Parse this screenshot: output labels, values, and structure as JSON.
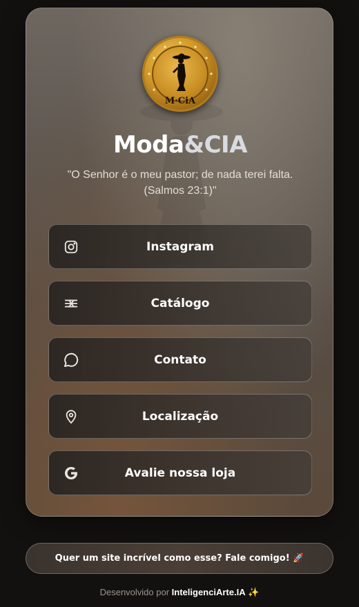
{
  "profile": {
    "brand_prefix": "Moda",
    "brand_suffix": "&CIA",
    "logo_text": "M·CiA",
    "quote_line1": "\"O Senhor é o meu pastor; de nada terei falta.",
    "quote_line2": "(Salmos 23:1)\""
  },
  "links": [
    {
      "label": "Instagram",
      "icon": "instagram-icon"
    },
    {
      "label": "Catálogo",
      "icon": "catalog-icon"
    },
    {
      "label": "Contato",
      "icon": "chat-bubble-icon"
    },
    {
      "label": "Localização",
      "icon": "map-pin-icon"
    },
    {
      "label": "Avalie nossa loja",
      "icon": "google-icon"
    }
  ],
  "cta": {
    "label": "Quer um site incrível como esse? Fale comigo! 🚀"
  },
  "footer": {
    "prefix": "Desenvolvido por",
    "brand": "InteligenciArte.IA",
    "emoji": "✨"
  },
  "colors": {
    "background": "#131110",
    "text": "#ffffff",
    "gold": "#d39a2a"
  }
}
